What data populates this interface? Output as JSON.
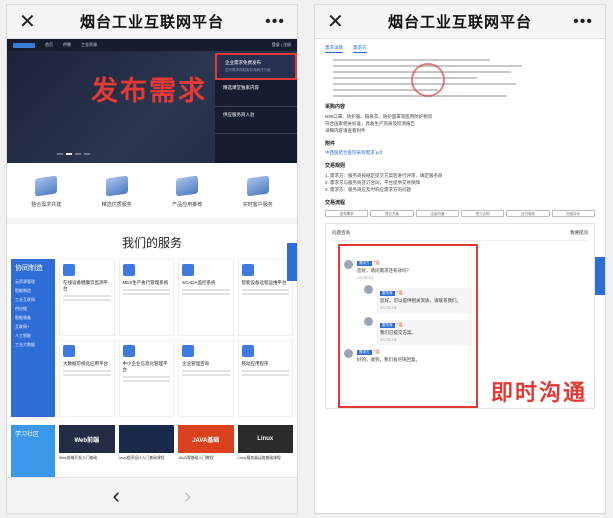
{
  "left": {
    "titlebar": {
      "close": "✕",
      "title": "烟台工业互联网平台",
      "more": "•••"
    },
    "mini_nav": [
      "首页",
      "供需",
      "工业资源"
    ],
    "mini_nav_right": "登录 | 注册",
    "banner_label": "发布需求",
    "banner_panel": [
      {
        "title": "企业需求免费发布",
        "sub": "发布需求获取服务商解决方案"
      },
      {
        "title": "精选课堂独家内容",
        "sub": ""
      },
      {
        "title": "供应服务商入驻",
        "sub": ""
      }
    ],
    "features": [
      "整合需求共建",
      "精选优质服务",
      "产品应用推荐",
      "实时客户服务"
    ],
    "services_title": "我们的服务",
    "services_sidebar": {
      "heading": "协同制造",
      "items": [
        "云资源管理",
        "智能制造",
        "工业互联网",
        "供应链",
        "智能装备",
        "互联网+",
        "人工智能",
        "工业大数据"
      ]
    },
    "services": [
      "在线设备健康云监测平台",
      "MES生产执行管理系统",
      "SCADA监控系统",
      "智能设备远程运维平台",
      "大数据可视化应用平台",
      "中小企业信息化管理平台",
      "企业管理咨询",
      "移动应用程序"
    ],
    "course_side": "学习社区",
    "courses": [
      {
        "img": "Web前端",
        "title": "Web前端开发入门基础",
        "color": "#222c44"
      },
      {
        "img": "",
        "title": "Java程序设计入门基础课程",
        "color": "#1b2a4a"
      },
      {
        "img": "JAVA基础",
        "title": "JAVA零基础入门教程",
        "color": "#d9411e"
      },
      {
        "img": "Linux",
        "title": "Linux服务器运维基础课程",
        "color": "#2b2b2b"
      }
    ],
    "nav": {
      "back": "‹",
      "forward": "›"
    }
  },
  "right": {
    "titlebar": {
      "close": "✕",
      "title": "烟台工业互联网平台",
      "more": "•••"
    },
    "doc_tabs": [
      "需求详情",
      "需求方"
    ],
    "sections": [
      {
        "heading": "采购内容",
        "lines": [
          "N95口罩、防护服、隔离衣、防护面罩等医用防护物资",
          "符合国家相关标准，具备生产资质及检测报告",
          "详细内容请查看附件"
        ]
      },
      {
        "heading": "附件",
        "link": "中西医结合医院采购需求.pdf"
      },
      {
        "heading": "交易规则",
        "lines": [
          "1. 需求方：服务商按规定提交方案后进行评审、确定服务商",
          "2. 需求方与服务商签订合同，平台提供交易保障",
          "3. 需求方：服务商应及时响应需求方的问题"
        ]
      }
    ],
    "flow_heading": "交易流程",
    "flow_steps": [
      "发布需求",
      "提交方案",
      "洽谈沟通",
      "签订合同",
      "交付验收",
      "完成评价"
    ],
    "chat": {
      "panel_title": "问题咨询",
      "panel_action": "我要提问",
      "messages": [
        {
          "name": "*远",
          "tag": "需求方",
          "text": "您好，请问需求还有效吗？",
          "meta": "2020年3月",
          "reply": false
        },
        {
          "name": "*远",
          "tag": "服务商",
          "text": "您好，可以提供相关资质，请联系我们。",
          "meta": "2020年3月",
          "reply": true
        },
        {
          "name": "*远",
          "tag": "服务商",
          "text": "我们已提交方案。",
          "meta": "2020年3月",
          "reply": true
        },
        {
          "name": "*远",
          "tag": "需求方",
          "text": "好的，收到，我们会尽快回复。",
          "meta": "",
          "reply": false
        }
      ]
    },
    "chat_label": "即时沟通"
  }
}
